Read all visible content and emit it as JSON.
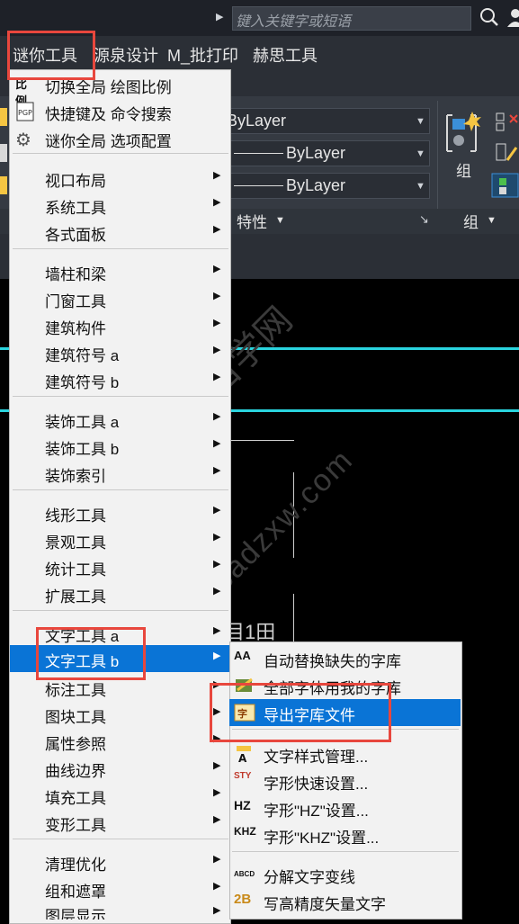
{
  "search": {
    "placeholder": "键入关键字或短语"
  },
  "menubar": {
    "items": [
      "谜你工具",
      "源泉设计",
      "M_批打印",
      "赫思工具"
    ]
  },
  "ribbon": {
    "layer_combo": "ByLayer",
    "color_combo": "ByLayer",
    "linetype_combo": "ByLayer",
    "properties_panel": "特性",
    "group_label": "组",
    "group_panel": "组"
  },
  "drawing": {
    "text": "目1田"
  },
  "watermark": {
    "line1": "CAD自学网",
    "line2": "www.cadzxw.com"
  },
  "main_menu": {
    "items": [
      "切换全局 绘图比例",
      "快捷键及 命令搜索",
      "谜你全局 选项配置",
      "视口布局",
      "系统工具",
      "各式面板",
      "墙柱和梁",
      "门窗工具",
      "建筑构件",
      "建筑符号 a",
      "建筑符号 b",
      "装饰工具 a",
      "装饰工具 b",
      "装饰索引",
      "线形工具",
      "景观工具",
      "统计工具",
      "扩展工具",
      "文字工具 a",
      "文字工具 b",
      "标注工具",
      "图块工具",
      "属性参照",
      "曲线边界",
      "填充工具",
      "变形工具",
      "清理优化",
      "组和遮罩",
      "图层显示"
    ]
  },
  "sub_menu": {
    "items": [
      "自动替换缺失的字库",
      "全部字体用我的字库",
      "导出字库文件",
      "文字样式管理...",
      "字形快速设置...",
      "字形\"HZ\"设置...",
      "字形\"KHZ\"设置...",
      "分解文字变线",
      "写高精度矢量文字"
    ],
    "icon_labels": [
      "AA",
      "STY",
      "HZ",
      "KHZ",
      "ABCD",
      "2B"
    ]
  },
  "colors": {
    "highlight": "#0a74d6",
    "annotation": "#e8473d",
    "accent_line": "#2ad4de"
  }
}
